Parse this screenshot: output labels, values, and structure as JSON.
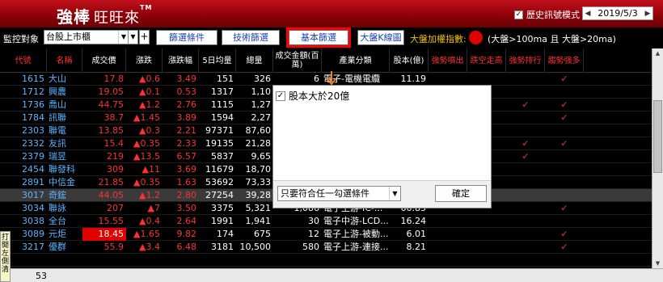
{
  "app": {
    "logo_main": "強棒",
    "logo_sub": "旺旺來",
    "logo_tm": "TM",
    "history_mode_label": "歷史訊號模式",
    "history_checked": "✓",
    "date": "2019/5/3"
  },
  "toolbar": {
    "monitor_label": "監控對象",
    "monitor_value": "台股上市櫃",
    "add": "+",
    "btn_filter": "篩選條件",
    "btn_tech": "技術篩選",
    "btn_basic": "基本篩選",
    "btn_kline": "大盤K線圖",
    "index_label": "大盤加權指數:",
    "index_note": "(大盤>100ma 且 大盤>20ma)",
    "index_color": "#e00000"
  },
  "table": {
    "headers": [
      "代號",
      "名稱",
      "成交價",
      "漲跌",
      "漲跌幅",
      "5日均量",
      "總量",
      "成交金額(百萬)",
      "產業分類",
      "股本(億)",
      "強勢噴出",
      "跌空走高",
      "強勢排行",
      "趨勢强多"
    ],
    "rows": [
      {
        "code": "1615",
        "name": "大山",
        "price": "17.8",
        "chg": "▲0.6",
        "pct": "3.49",
        "v5": "151",
        "vol": "326",
        "amt": "6",
        "ind": "電子-電機電纜",
        "cap": "11.19",
        "s1": "",
        "s2": "",
        "s3": "",
        "s4": "✓",
        "up": true
      },
      {
        "code": "1712",
        "name": "興農",
        "price": "19.05",
        "chg": "▲0.1",
        "pct": "0.53",
        "v5": "1317",
        "vol": "1,10",
        "amt": "",
        "ind": "",
        "cap": "",
        "s1": "",
        "s2": "",
        "s3": "",
        "s4": "",
        "up": true
      },
      {
        "code": "1736",
        "name": "喬山",
        "price": "44.75",
        "chg": "▲1.2",
        "pct": "2.76",
        "v5": "1115",
        "vol": "1,27",
        "amt": "",
        "ind": "",
        "cap": "",
        "s1": "",
        "s2": "",
        "s3": "✓",
        "s4": "✓",
        "up": true
      },
      {
        "code": "1784",
        "name": "訊聯",
        "price": "38.7",
        "chg": "▲1.45",
        "pct": "3.89",
        "v5": "1594",
        "vol": "2,27",
        "amt": "",
        "ind": "",
        "cap": "",
        "s1": "",
        "s2": "",
        "s3": "",
        "s4": "✓",
        "up": true
      },
      {
        "code": "2303",
        "name": "聯電",
        "price": "13.85",
        "chg": "▲0.3",
        "pct": "2.21",
        "v5": "97371",
        "vol": "87,60",
        "amt": "",
        "ind": "",
        "cap": "",
        "s1": "",
        "s2": "",
        "s3": "",
        "s4": "",
        "up": true
      },
      {
        "code": "2332",
        "name": "友訊",
        "price": "15.4",
        "chg": "▲0.35",
        "pct": "2.33",
        "v5": "19135",
        "vol": "21,28",
        "amt": "",
        "ind": "",
        "cap": "",
        "s1": "",
        "s2": "",
        "s3": "✓",
        "s4": "✓",
        "up": true
      },
      {
        "code": "2379",
        "name": "瑞昱",
        "price": "219",
        "chg": "▲13.5",
        "pct": "6.57",
        "v5": "5837",
        "vol": "9,65",
        "amt": "",
        "ind": "",
        "cap": "",
        "s1": "",
        "s2": "",
        "s3": "✓",
        "s4": "",
        "up": true
      },
      {
        "code": "2454",
        "name": "聯發科",
        "price": "309",
        "chg": "▲11",
        "pct": "3.69",
        "v5": "11679",
        "vol": "18,70",
        "amt": "",
        "ind": "",
        "cap": "",
        "s1": "",
        "s2": "",
        "s3": "",
        "s4": "",
        "up": true
      },
      {
        "code": "2891",
        "name": "中信金",
        "price": "21.85",
        "chg": "▲0.35",
        "pct": "1.63",
        "v5": "53692",
        "vol": "73,33",
        "amt": "",
        "ind": "",
        "cap": "",
        "s1": "",
        "s2": "",
        "s3": "",
        "s4": "",
        "up": true
      },
      {
        "code": "3017",
        "name": "奇鋐",
        "price": "44.05",
        "chg": "▲1.2",
        "pct": "2.80",
        "v5": "27254",
        "vol": "39,28",
        "amt": "",
        "ind": "",
        "cap": "",
        "s1": "",
        "s2": "",
        "s3": "",
        "s4": "",
        "up": true,
        "sel": true
      },
      {
        "code": "3034",
        "name": "聯詠",
        "price": "207",
        "chg": "▲7",
        "pct": "3.50",
        "v5": "3375",
        "vol": "5,321",
        "amt": "1,086",
        "ind": "電子上游-IC-...",
        "cap": "60.85",
        "s1": "",
        "s2": "",
        "s3": "",
        "s4": "✓",
        "up": true
      },
      {
        "code": "3038",
        "name": "全台",
        "price": "15.55",
        "chg": "▲0.4",
        "pct": "2.64",
        "v5": "1991",
        "vol": "1,941",
        "amt": "30",
        "ind": "電子中游-LCD...",
        "cap": "16.24",
        "s1": "",
        "s2": "",
        "s3": "",
        "s4": "",
        "up": true
      },
      {
        "code": "3089",
        "name": "元炬",
        "price": "18.45",
        "chg": "▲1.65",
        "pct": "9.82",
        "v5": "174",
        "vol": "675",
        "amt": "12",
        "ind": "電子上游-被動...",
        "cap": "6.01",
        "s1": "",
        "s2": "",
        "s3": "",
        "s4": "✓",
        "up": true,
        "limit": true
      },
      {
        "code": "3217",
        "name": "優群",
        "price": "55.9",
        "chg": "▲3.4",
        "pct": "6.48",
        "v5": "3181",
        "vol": "10,500",
        "amt": "580",
        "ind": "電子上游-連接...",
        "cap": "8.21",
        "s1": "",
        "s2": "",
        "s3": "",
        "s4": "✓",
        "up": true
      },
      {
        "code": "",
        "name": "",
        "price": "",
        "chg": "",
        "pct": "",
        "v5": "",
        "vol": "",
        "amt": "",
        "ind": "",
        "cap": "",
        "s1": "",
        "s2": "",
        "s3": "",
        "s4": "",
        "up": true
      }
    ]
  },
  "side_tab": "打開左側清",
  "status": {
    "count": "53"
  },
  "popup": {
    "option_label": "股本大於20億",
    "option_checked": "✓",
    "mode_value": "只要符合任一勾選條件",
    "ok_label": "確定"
  }
}
